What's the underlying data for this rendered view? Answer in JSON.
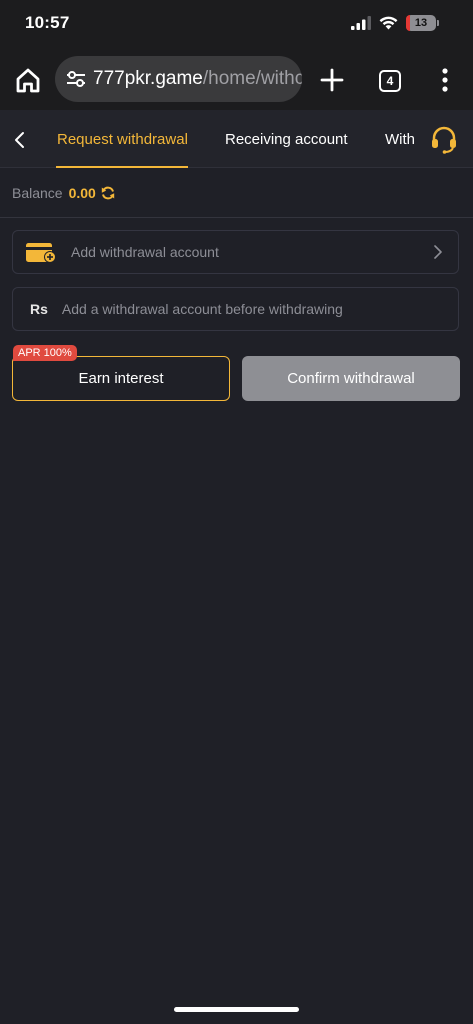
{
  "status_bar": {
    "time": "10:57",
    "battery_level": "13",
    "icons": [
      "signal-icon",
      "wifi-icon",
      "battery-icon"
    ]
  },
  "browser": {
    "url_domain": "777pkr.game",
    "url_path": "/home/withc",
    "tab_count": "4",
    "icons": [
      "home-icon",
      "tune-icon",
      "plus-icon",
      "tabs-icon",
      "menu-icon"
    ]
  },
  "nav": {
    "tabs": [
      {
        "label": "Request withdrawal",
        "active": true
      },
      {
        "label": "Receiving account",
        "active": false
      },
      {
        "label": "With",
        "active": false
      }
    ],
    "icons": [
      "back-icon",
      "headset-icon"
    ]
  },
  "balance": {
    "label": "Balance",
    "value": "0.00"
  },
  "form": {
    "account_label": "Add withdrawal account",
    "currency_symbol": "Rs",
    "amount_placeholder": "Add a withdrawal account before withdrawing"
  },
  "actions": {
    "apr_badge": "APR 100%",
    "earn_label": "Earn interest",
    "confirm_label": "Confirm withdrawal"
  },
  "colors": {
    "accent": "#f3b739",
    "background": "#1f2027",
    "badge": "#e04a3f",
    "disabled_button": "#8e8f94"
  }
}
